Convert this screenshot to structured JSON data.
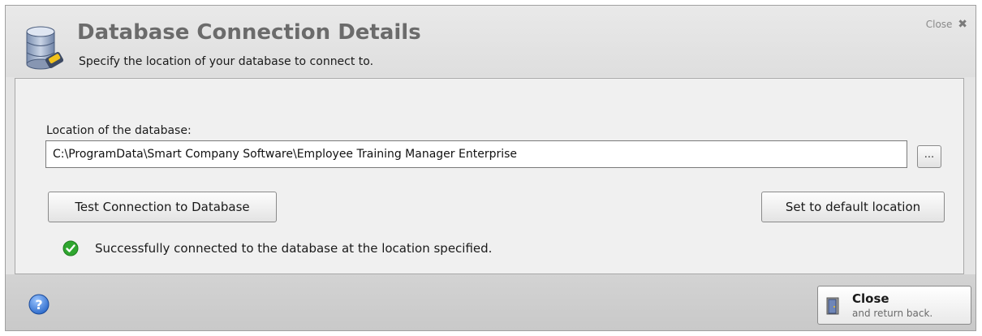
{
  "dialog": {
    "title": "Database Connection Details",
    "subtitle": "Specify the location of your database to connect to.",
    "close_link_label": "Close",
    "close_link_icon": "close-x-icon",
    "header_icon": "database-icon"
  },
  "location": {
    "label": "Location of the database:",
    "value": "C:\\ProgramData\\Smart Company Software\\Employee Training Manager Enterprise",
    "browse_label": "..."
  },
  "buttons": {
    "test_connection": "Test Connection to Database",
    "set_default": "Set to default location"
  },
  "status": {
    "icon": "success-check-icon",
    "text": "Successfully connected to the database at the location specified."
  },
  "footer": {
    "help_icon": "help-icon",
    "close_label": "Close",
    "close_sublabel": "and return back."
  },
  "colors": {
    "title": "#6b6b6b",
    "success": "#2fa62f",
    "help": "#2d6fd2"
  }
}
